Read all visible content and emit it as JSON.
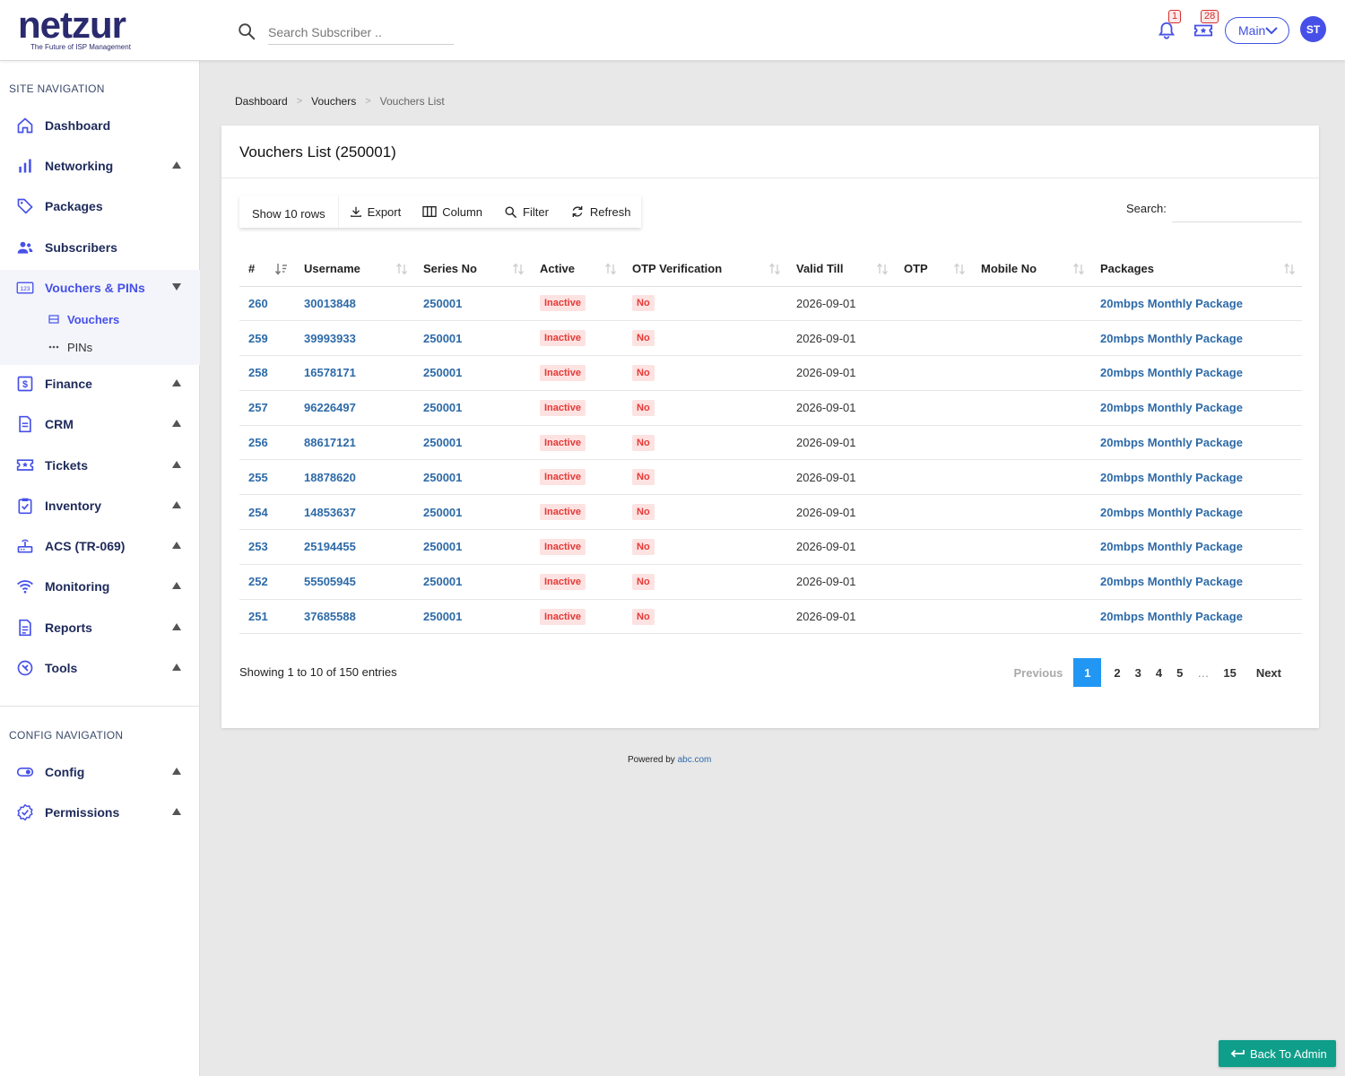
{
  "header": {
    "logo_text": "netzur",
    "logo_tagline": "The Future of ISP Management",
    "search_placeholder": "Search Subscriber ..",
    "notifications_count": "1",
    "tickets_count": "28",
    "workspace_select": "Main",
    "avatar_initials": "ST"
  },
  "sidebar": {
    "site_heading": "SITE NAVIGATION",
    "config_heading": "CONFIG NAVIGATION",
    "items": [
      {
        "label": "Dashboard",
        "icon": "home-icon"
      },
      {
        "label": "Networking",
        "icon": "bar-chart-icon"
      },
      {
        "label": "Packages",
        "icon": "tag-icon"
      },
      {
        "label": "Subscribers",
        "icon": "users-icon"
      },
      {
        "label": "Vouchers & PINs",
        "icon": "numbers-icon"
      },
      {
        "label": "Finance",
        "icon": "dollar-icon"
      },
      {
        "label": "CRM",
        "icon": "document-icon"
      },
      {
        "label": "Tickets",
        "icon": "ticket-icon"
      },
      {
        "label": "Inventory",
        "icon": "clipboard-check-icon"
      },
      {
        "label": "ACS (TR-069)",
        "icon": "router-icon"
      },
      {
        "label": "Monitoring",
        "icon": "wifi-icon"
      },
      {
        "label": "Reports",
        "icon": "report-icon"
      },
      {
        "label": "Tools",
        "icon": "tools-icon"
      }
    ],
    "subitems": [
      {
        "label": "Vouchers",
        "icon": "list-icon"
      },
      {
        "label": "PINs",
        "icon": "dots-icon"
      }
    ],
    "config_items": [
      {
        "label": "Config",
        "icon": "toggle-icon"
      },
      {
        "label": "Permissions",
        "icon": "badge-check-icon"
      }
    ]
  },
  "breadcrumb": [
    "Dashboard",
    "Vouchers",
    "Vouchers List"
  ],
  "card": {
    "title": "Vouchers List (250001)",
    "toolbar": {
      "show_rows": "Show 10 rows",
      "export": "Export",
      "column": "Column",
      "filter": "Filter",
      "refresh": "Refresh"
    },
    "search_label": "Search:",
    "columns": [
      "#",
      "Username",
      "Series No",
      "Active",
      "OTP Verification",
      "Valid Till",
      "OTP",
      "Mobile No",
      "Packages"
    ],
    "rows": [
      {
        "id": "260",
        "username": "30013848",
        "series": "250001",
        "active": "Inactive",
        "otp_verification": "No",
        "valid_till": "2026-09-01",
        "otp": "",
        "mobile": "",
        "package": "20mbps Monthly Package"
      },
      {
        "id": "259",
        "username": "39993933",
        "series": "250001",
        "active": "Inactive",
        "otp_verification": "No",
        "valid_till": "2026-09-01",
        "otp": "",
        "mobile": "",
        "package": "20mbps Monthly Package"
      },
      {
        "id": "258",
        "username": "16578171",
        "series": "250001",
        "active": "Inactive",
        "otp_verification": "No",
        "valid_till": "2026-09-01",
        "otp": "",
        "mobile": "",
        "package": "20mbps Monthly Package"
      },
      {
        "id": "257",
        "username": "96226497",
        "series": "250001",
        "active": "Inactive",
        "otp_verification": "No",
        "valid_till": "2026-09-01",
        "otp": "",
        "mobile": "",
        "package": "20mbps Monthly Package"
      },
      {
        "id": "256",
        "username": "88617121",
        "series": "250001",
        "active": "Inactive",
        "otp_verification": "No",
        "valid_till": "2026-09-01",
        "otp": "",
        "mobile": "",
        "package": "20mbps Monthly Package"
      },
      {
        "id": "255",
        "username": "18878620",
        "series": "250001",
        "active": "Inactive",
        "otp_verification": "No",
        "valid_till": "2026-09-01",
        "otp": "",
        "mobile": "",
        "package": "20mbps Monthly Package"
      },
      {
        "id": "254",
        "username": "14853637",
        "series": "250001",
        "active": "Inactive",
        "otp_verification": "No",
        "valid_till": "2026-09-01",
        "otp": "",
        "mobile": "",
        "package": "20mbps Monthly Package"
      },
      {
        "id": "253",
        "username": "25194455",
        "series": "250001",
        "active": "Inactive",
        "otp_verification": "No",
        "valid_till": "2026-09-01",
        "otp": "",
        "mobile": "",
        "package": "20mbps Monthly Package"
      },
      {
        "id": "252",
        "username": "55505945",
        "series": "250001",
        "active": "Inactive",
        "otp_verification": "No",
        "valid_till": "2026-09-01",
        "otp": "",
        "mobile": "",
        "package": "20mbps Monthly Package"
      },
      {
        "id": "251",
        "username": "37685588",
        "series": "250001",
        "active": "Inactive",
        "otp_verification": "No",
        "valid_till": "2026-09-01",
        "otp": "",
        "mobile": "",
        "package": "20mbps Monthly Package"
      }
    ],
    "showing": "Showing 1 to 10 of 150 entries",
    "pagination": {
      "previous": "Previous",
      "pages": [
        "1",
        "2",
        "3",
        "4",
        "5",
        "…",
        "15"
      ],
      "current": "1",
      "next": "Next"
    }
  },
  "footer": {
    "text": "Powered by ",
    "link": "abc.com"
  },
  "back_button": "Back To Admin",
  "colors": {
    "brand": "#4650e8",
    "link": "#2d6aa8",
    "danger": "#e53935",
    "accent_teal": "#0f9e8a",
    "active_page": "#2196f3"
  }
}
